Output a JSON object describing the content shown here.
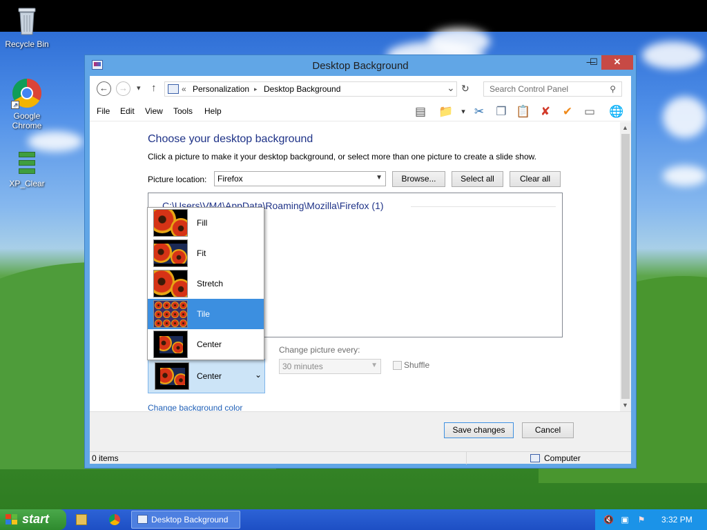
{
  "desktop": {
    "icons": [
      {
        "label": "Recycle Bin",
        "icon": "recycle-bin-icon"
      },
      {
        "label": "Google Chrome",
        "icon": "chrome-icon"
      },
      {
        "label": "XP_Clear",
        "icon": "xp-clear-icon"
      }
    ]
  },
  "window": {
    "title": "Desktop Background",
    "controls": {
      "minimize": "—",
      "maximize": "☐",
      "close": "✕"
    }
  },
  "address": {
    "back": "←",
    "forward": "→",
    "recent": "▾",
    "up": "↑",
    "prefix": "«",
    "segments": [
      "Personalization",
      "Desktop Background"
    ],
    "separator": "▸",
    "dropdown": "⌄",
    "refresh": "↻",
    "search_placeholder": "Search Control Panel",
    "search_icon": "⚲"
  },
  "menu": {
    "items": [
      "File",
      "Edit",
      "View",
      "Tools",
      "Help"
    ],
    "toolbar_icons": [
      "layout-icon",
      "folder-check-icon",
      "dropdown-icon",
      "cut-icon",
      "copy-icon",
      "paste-icon",
      "delete-icon",
      "check-icon",
      "rename-icon",
      "globe-icon"
    ],
    "toolbar_glyphs": [
      "▤",
      "📁",
      "▾",
      "✂",
      "❐",
      "📋",
      "✘",
      "✔",
      "▭",
      "🌐"
    ]
  },
  "content": {
    "heading": "Choose your desktop background",
    "description": "Click a picture to make it your desktop background, or select more than one picture to create a slide show.",
    "picture_location_label": "Picture location:",
    "picture_location_value": "Firefox",
    "browse": "Browse...",
    "select_all": "Select all",
    "clear_all": "Clear all",
    "group_header": "C:\\Users\\VM4\\AppData\\Roaming\\Mozilla\\Firefox (1)",
    "change_picture_label": "Change picture every:",
    "change_picture_value": "30 minutes",
    "shuffle_label": "Shuffle",
    "picture_position_value": "Center",
    "change_bg_color_link": "Change background color"
  },
  "dropdown": {
    "options": [
      "Fill",
      "Fit",
      "Stretch",
      "Tile",
      "Center"
    ],
    "selected": "Tile"
  },
  "footer": {
    "save": "Save changes",
    "cancel": "Cancel"
  },
  "status": {
    "items": "0 items",
    "location": "Computer"
  },
  "taskbar": {
    "start": "start",
    "active_window": "Desktop Background",
    "clock": "3:32 PM"
  },
  "colors": {
    "accent": "#3c8fe0",
    "window_frame": "#61a6e6",
    "close_button": "#c74a45",
    "taskbar": "#2d63d6",
    "start_button": "#3f9e3f"
  }
}
